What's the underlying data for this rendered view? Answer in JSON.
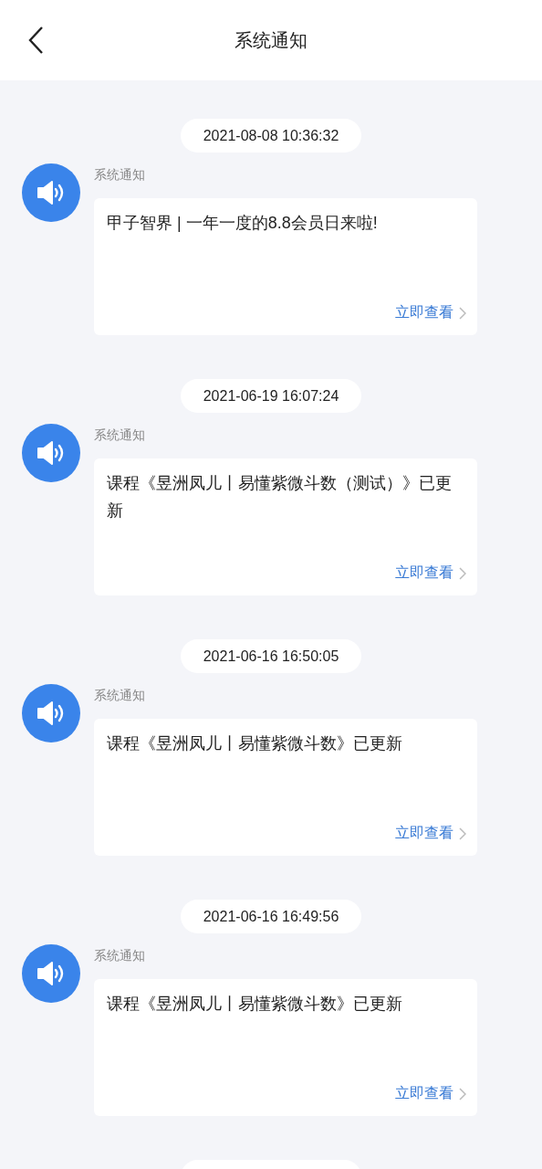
{
  "header": {
    "title": "系统通知"
  },
  "notices": [
    {
      "time": "2021-08-08 10:36:32",
      "sender": "系统通知",
      "message": "甲子智界 | 一年一度的8.8会员日来啦!",
      "action": "立即查看"
    },
    {
      "time": "2021-06-19 16:07:24",
      "sender": "系统通知",
      "message": "课程《昱洲凤儿丨易懂紫微斗数（测试）》已更新",
      "action": "立即查看"
    },
    {
      "time": "2021-06-16 16:50:05",
      "sender": "系统通知",
      "message": "课程《昱洲凤儿丨易懂紫微斗数》已更新",
      "action": "立即查看"
    },
    {
      "time": "2021-06-16 16:49:56",
      "sender": "系统通知",
      "message": "课程《昱洲凤儿丨易懂紫微斗数》已更新",
      "action": "立即查看"
    }
  ],
  "more_below": true
}
